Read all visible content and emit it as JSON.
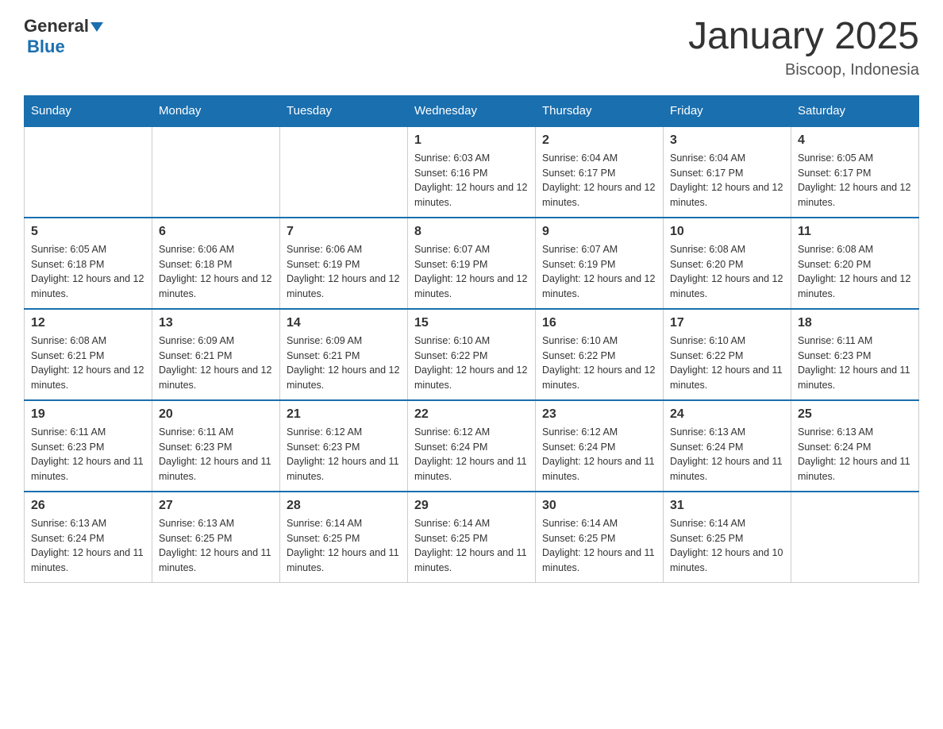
{
  "header": {
    "logo": {
      "general": "General",
      "blue": "Blue",
      "tagline": ""
    },
    "title": "January 2025",
    "subtitle": "Biscoop, Indonesia"
  },
  "weekdays": [
    "Sunday",
    "Monday",
    "Tuesday",
    "Wednesday",
    "Thursday",
    "Friday",
    "Saturday"
  ],
  "weeks": [
    [
      null,
      null,
      null,
      {
        "day": 1,
        "sunrise": "6:03 AM",
        "sunset": "6:16 PM",
        "daylight": "12 hours and 12 minutes."
      },
      {
        "day": 2,
        "sunrise": "6:04 AM",
        "sunset": "6:17 PM",
        "daylight": "12 hours and 12 minutes."
      },
      {
        "day": 3,
        "sunrise": "6:04 AM",
        "sunset": "6:17 PM",
        "daylight": "12 hours and 12 minutes."
      },
      {
        "day": 4,
        "sunrise": "6:05 AM",
        "sunset": "6:17 PM",
        "daylight": "12 hours and 12 minutes."
      }
    ],
    [
      {
        "day": 5,
        "sunrise": "6:05 AM",
        "sunset": "6:18 PM",
        "daylight": "12 hours and 12 minutes."
      },
      {
        "day": 6,
        "sunrise": "6:06 AM",
        "sunset": "6:18 PM",
        "daylight": "12 hours and 12 minutes."
      },
      {
        "day": 7,
        "sunrise": "6:06 AM",
        "sunset": "6:19 PM",
        "daylight": "12 hours and 12 minutes."
      },
      {
        "day": 8,
        "sunrise": "6:07 AM",
        "sunset": "6:19 PM",
        "daylight": "12 hours and 12 minutes."
      },
      {
        "day": 9,
        "sunrise": "6:07 AM",
        "sunset": "6:19 PM",
        "daylight": "12 hours and 12 minutes."
      },
      {
        "day": 10,
        "sunrise": "6:08 AM",
        "sunset": "6:20 PM",
        "daylight": "12 hours and 12 minutes."
      },
      {
        "day": 11,
        "sunrise": "6:08 AM",
        "sunset": "6:20 PM",
        "daylight": "12 hours and 12 minutes."
      }
    ],
    [
      {
        "day": 12,
        "sunrise": "6:08 AM",
        "sunset": "6:21 PM",
        "daylight": "12 hours and 12 minutes."
      },
      {
        "day": 13,
        "sunrise": "6:09 AM",
        "sunset": "6:21 PM",
        "daylight": "12 hours and 12 minutes."
      },
      {
        "day": 14,
        "sunrise": "6:09 AM",
        "sunset": "6:21 PM",
        "daylight": "12 hours and 12 minutes."
      },
      {
        "day": 15,
        "sunrise": "6:10 AM",
        "sunset": "6:22 PM",
        "daylight": "12 hours and 12 minutes."
      },
      {
        "day": 16,
        "sunrise": "6:10 AM",
        "sunset": "6:22 PM",
        "daylight": "12 hours and 12 minutes."
      },
      {
        "day": 17,
        "sunrise": "6:10 AM",
        "sunset": "6:22 PM",
        "daylight": "12 hours and 11 minutes."
      },
      {
        "day": 18,
        "sunrise": "6:11 AM",
        "sunset": "6:23 PM",
        "daylight": "12 hours and 11 minutes."
      }
    ],
    [
      {
        "day": 19,
        "sunrise": "6:11 AM",
        "sunset": "6:23 PM",
        "daylight": "12 hours and 11 minutes."
      },
      {
        "day": 20,
        "sunrise": "6:11 AM",
        "sunset": "6:23 PM",
        "daylight": "12 hours and 11 minutes."
      },
      {
        "day": 21,
        "sunrise": "6:12 AM",
        "sunset": "6:23 PM",
        "daylight": "12 hours and 11 minutes."
      },
      {
        "day": 22,
        "sunrise": "6:12 AM",
        "sunset": "6:24 PM",
        "daylight": "12 hours and 11 minutes."
      },
      {
        "day": 23,
        "sunrise": "6:12 AM",
        "sunset": "6:24 PM",
        "daylight": "12 hours and 11 minutes."
      },
      {
        "day": 24,
        "sunrise": "6:13 AM",
        "sunset": "6:24 PM",
        "daylight": "12 hours and 11 minutes."
      },
      {
        "day": 25,
        "sunrise": "6:13 AM",
        "sunset": "6:24 PM",
        "daylight": "12 hours and 11 minutes."
      }
    ],
    [
      {
        "day": 26,
        "sunrise": "6:13 AM",
        "sunset": "6:24 PM",
        "daylight": "12 hours and 11 minutes."
      },
      {
        "day": 27,
        "sunrise": "6:13 AM",
        "sunset": "6:25 PM",
        "daylight": "12 hours and 11 minutes."
      },
      {
        "day": 28,
        "sunrise": "6:14 AM",
        "sunset": "6:25 PM",
        "daylight": "12 hours and 11 minutes."
      },
      {
        "day": 29,
        "sunrise": "6:14 AM",
        "sunset": "6:25 PM",
        "daylight": "12 hours and 11 minutes."
      },
      {
        "day": 30,
        "sunrise": "6:14 AM",
        "sunset": "6:25 PM",
        "daylight": "12 hours and 11 minutes."
      },
      {
        "day": 31,
        "sunrise": "6:14 AM",
        "sunset": "6:25 PM",
        "daylight": "12 hours and 10 minutes."
      },
      null
    ]
  ],
  "labels": {
    "sunrise_prefix": "Sunrise: ",
    "sunset_prefix": "Sunset: ",
    "daylight_prefix": "Daylight: "
  }
}
